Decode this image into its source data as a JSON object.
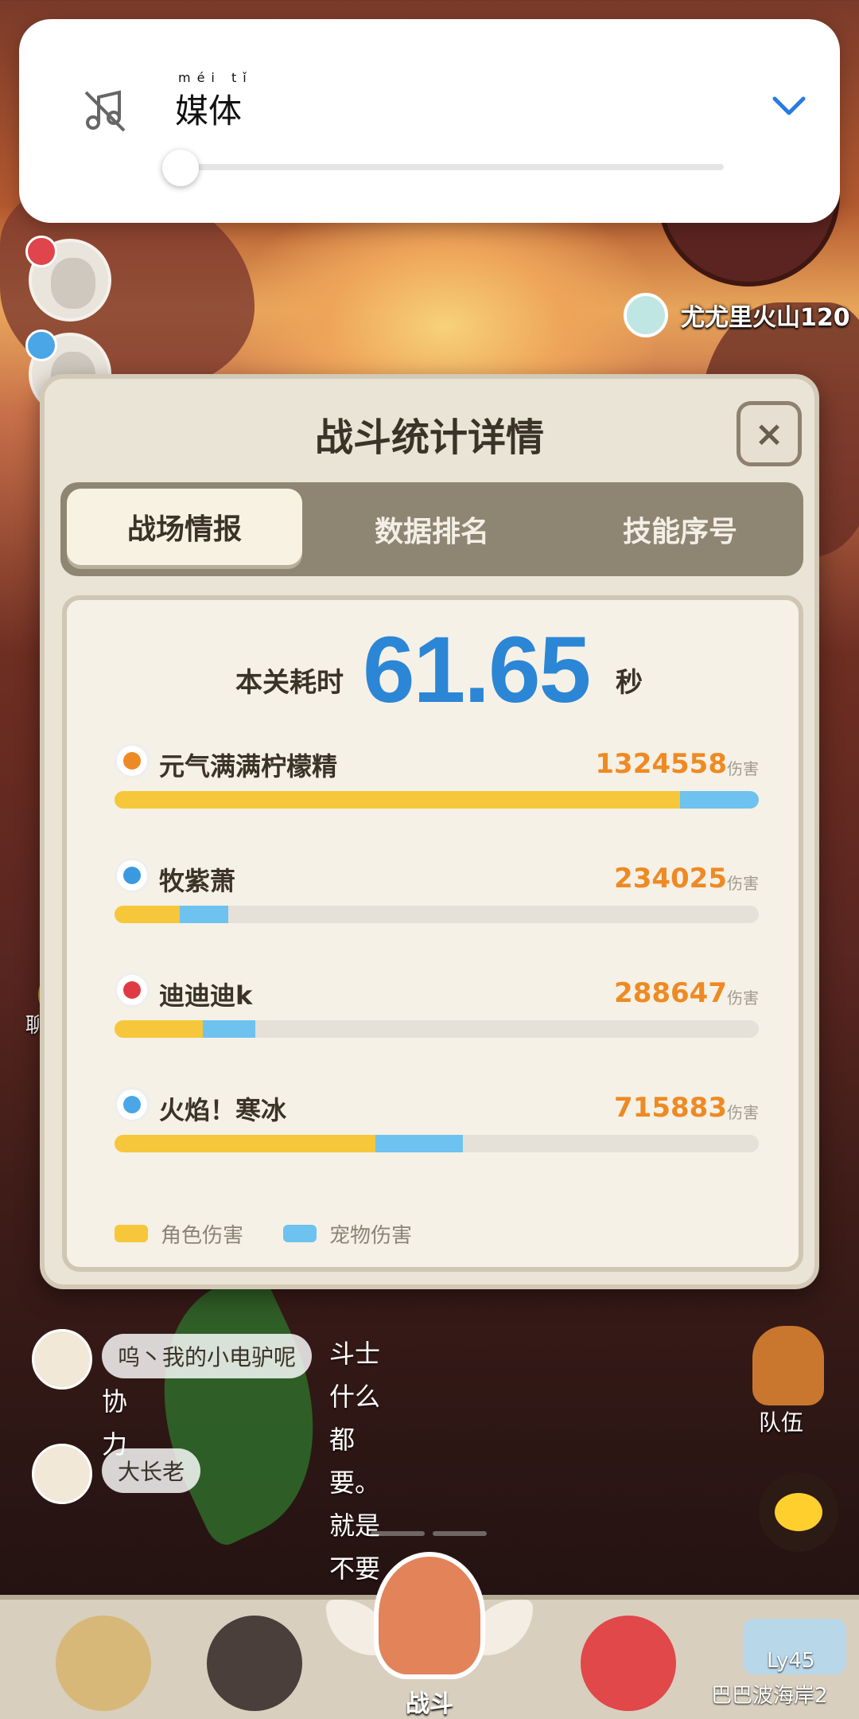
{
  "media_panel": {
    "pinyin": "méi tǐ",
    "label": "媒体",
    "volume_level": 0.0,
    "icon": "music-muted-icon",
    "expand_icon": "chevron-down-icon",
    "accent": "#2a7ae2"
  },
  "location": {
    "label": "尤尤里火山120",
    "icon": "map-pin-icon"
  },
  "dialog": {
    "title": "战斗统计详情",
    "close_label": "×",
    "tabs": [
      {
        "label": "战场情报",
        "active": true
      },
      {
        "label": "数据排名",
        "active": false
      },
      {
        "label": "技能序号",
        "active": false
      }
    ],
    "time": {
      "label": "本关耗时",
      "value": "61.65",
      "unit": "秒"
    },
    "max_damage": 1324558,
    "players": [
      {
        "name": "元气满满柠檬精",
        "damage": "1324558",
        "unit": "伤害",
        "role_fraction": 0.878,
        "pet_fraction": 0.122,
        "element_color": "#ee8a24",
        "icon": "fire-element-icon"
      },
      {
        "name": "牧紫萧",
        "damage": "234025",
        "unit": "伤害",
        "role_fraction": 0.57,
        "pet_fraction": 0.43,
        "element_color": "#3a9ae0",
        "icon": "wind-element-icon"
      },
      {
        "name": "迪迪迪k",
        "damage": "288647",
        "unit": "伤害",
        "role_fraction": 0.63,
        "pet_fraction": 0.37,
        "element_color": "#e03a44",
        "icon": "flame-element-icon"
      },
      {
        "name": "火焰！寒冰",
        "damage": "715883",
        "unit": "伤害",
        "role_fraction": 0.75,
        "pet_fraction": 0.25,
        "element_color": "#4aa6e6",
        "icon": "ice-element-icon"
      }
    ],
    "legend": [
      {
        "label": "角色伤害",
        "color": "#f6c73a"
      },
      {
        "label": "宠物伤害",
        "color": "#6ec2ef"
      }
    ]
  },
  "chat": {
    "button_label": "聊天",
    "messages": [
      {
        "tag": "呜丶我的小电驴呢",
        "text_line1": "斗士什么都要。就是不要",
        "text_line2": "协力"
      },
      {
        "tag": "大长老",
        "text_line1": "",
        "text_line2": ""
      }
    ]
  },
  "team": {
    "label": "队伍"
  },
  "bottom_nav": {
    "battle_label": "战斗",
    "locked_level": "Ly45",
    "locked_name": "巴巴波海岸2"
  }
}
